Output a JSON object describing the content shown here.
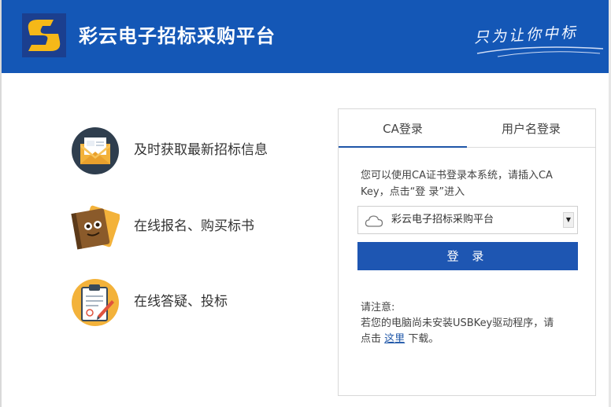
{
  "header": {
    "title": "彩云电子招标采购平台",
    "slogan": "只为让你中标",
    "bg_color": "#1457b6",
    "logo_icon": "s-logo-icon"
  },
  "features": [
    {
      "icon": "envelope-icon",
      "text": "及时获取最新招标信息"
    },
    {
      "icon": "book-icon",
      "text": "在线报名、购买标书"
    },
    {
      "icon": "clipboard-icon",
      "text": "在线答疑、投标"
    }
  ],
  "login": {
    "tabs": [
      {
        "label": "CA登录",
        "active": true
      },
      {
        "label": "用户名登录",
        "active": false
      }
    ],
    "tip": "您可以使用CA证书登录本系统，请插入CA Key，点击“登 录”进入",
    "select": {
      "icon": "cloud-icon",
      "value": "彩云电子招标采购平台"
    },
    "button_label": "登 录",
    "accent_color": "#1e56b2",
    "notice": {
      "title": "请注意:",
      "line1": "若您的电脑尚未安装USBKey驱动程序，请",
      "line2_prefix": "点击",
      "link": "这里",
      "line2_suffix": "下载。"
    }
  }
}
